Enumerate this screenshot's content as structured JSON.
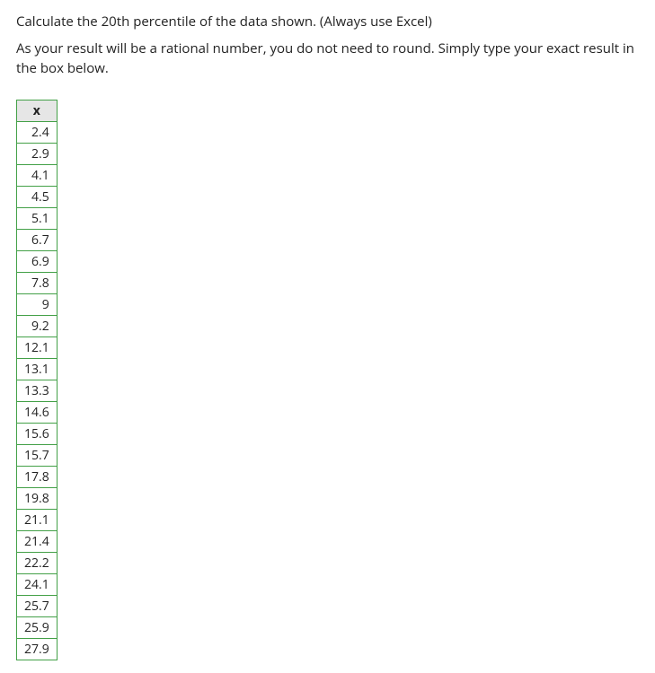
{
  "question": {
    "line1": "Calculate the 20th percentile of the data shown. (Always use Excel)",
    "line2": "As your result will be a rational number, you do not need to round. Simply type your exact result in the box below."
  },
  "table": {
    "header": "x",
    "values": [
      "2.4",
      "2.9",
      "4.1",
      "4.5",
      "5.1",
      "6.7",
      "6.9",
      "7.8",
      "9",
      "9.2",
      "12.1",
      "13.1",
      "13.3",
      "14.6",
      "15.6",
      "15.7",
      "17.8",
      "19.8",
      "21.1",
      "21.4",
      "22.2",
      "24.1",
      "25.7",
      "25.9",
      "27.9"
    ]
  }
}
